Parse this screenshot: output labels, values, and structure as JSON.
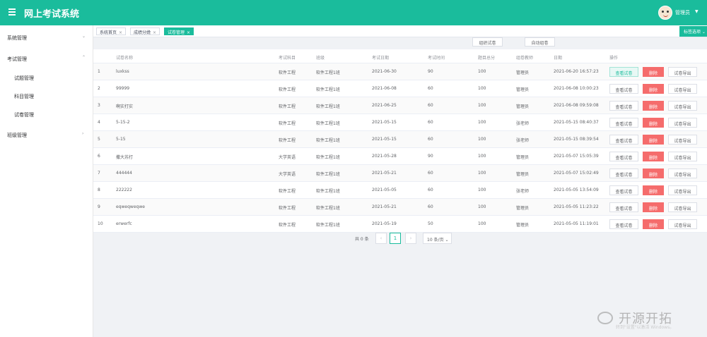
{
  "header": {
    "app_title": "网上考试系统",
    "username": "管理员",
    "colors": {
      "brand": "#1abc9c"
    }
  },
  "sidebar": {
    "items": [
      {
        "label": "系统管理",
        "chevron": "⌄"
      },
      {
        "label": "考试管理",
        "chevron": "⌃"
      },
      {
        "label": "试题管理"
      },
      {
        "label": "科目管理"
      },
      {
        "label": "试卷管理"
      },
      {
        "label": "班级管理",
        "chevron": "›"
      }
    ]
  },
  "tabs": [
    {
      "label": "系统首页"
    },
    {
      "label": "成绩分娩"
    },
    {
      "label": "试卷管理"
    }
  ],
  "tab_options": "标签选项 ⌄",
  "toolbar": {
    "manual_paper": "组织试卷",
    "auto_paper": "自动组卷"
  },
  "table": {
    "columns": [
      "试卷名称",
      "考试科目",
      "班级",
      "考试日期",
      "考试时间",
      "题目总分",
      "组卷教师",
      "日期",
      "操作"
    ],
    "rows": [
      {
        "no": "1",
        "name": "luxkss",
        "subject": "软件工程",
        "class": "软件工程1班",
        "exam_date": "2021-06-30",
        "duration": "90",
        "score": "100",
        "teacher": "管理员",
        "date": "2021-06-20 16:57:23"
      },
      {
        "no": "2",
        "name": "99999",
        "subject": "软件工程",
        "class": "软件工程1班",
        "exam_date": "2021-06-08",
        "duration": "60",
        "score": "100",
        "teacher": "管理员",
        "date": "2021-06-08 10:00:23"
      },
      {
        "no": "3",
        "name": "啊实打实",
        "subject": "软件工程",
        "class": "软件工程1班",
        "exam_date": "2021-06-25",
        "duration": "60",
        "score": "100",
        "teacher": "管理员",
        "date": "2021-06-08 09:59:08"
      },
      {
        "no": "4",
        "name": "5-15-2",
        "subject": "软件工程",
        "class": "软件工程1班",
        "exam_date": "2021-05-15",
        "duration": "60",
        "score": "100",
        "teacher": "张老师",
        "date": "2021-05-15 08:40:37"
      },
      {
        "no": "5",
        "name": "5-15",
        "subject": "软件工程",
        "class": "软件工程1班",
        "exam_date": "2021-05-15",
        "duration": "60",
        "score": "100",
        "teacher": "张老师",
        "date": "2021-05-15 08:39:54"
      },
      {
        "no": "6",
        "name": "撒大苏打",
        "subject": "大学英语",
        "class": "软件工程1班",
        "exam_date": "2021-05-28",
        "duration": "90",
        "score": "100",
        "teacher": "管理员",
        "date": "2021-05-07 15:05:39"
      },
      {
        "no": "7",
        "name": "444444",
        "subject": "大学英语",
        "class": "软件工程1班",
        "exam_date": "2021-05-21",
        "duration": "60",
        "score": "100",
        "teacher": "管理员",
        "date": "2021-05-07 15:02:49"
      },
      {
        "no": "8",
        "name": "222222",
        "subject": "软件工程",
        "class": "软件工程1班",
        "exam_date": "2021-05-05",
        "duration": "60",
        "score": "100",
        "teacher": "张老师",
        "date": "2021-05-05 13:54:09"
      },
      {
        "no": "9",
        "name": "eqweqweqwe",
        "subject": "软件工程",
        "class": "软件工程1班",
        "exam_date": "2021-05-21",
        "duration": "60",
        "score": "100",
        "teacher": "管理员",
        "date": "2021-05-05 11:23:22"
      },
      {
        "no": "10",
        "name": "erwerfc",
        "subject": "软件工程",
        "class": "软件工程1班",
        "exam_date": "2021-05-19",
        "duration": "50",
        "score": "100",
        "teacher": "管理员",
        "date": "2021-05-05 11:19:01"
      }
    ],
    "actions": {
      "view": "查看试卷",
      "delete": "删除",
      "export": "试卷导出"
    }
  },
  "pagination": {
    "total_text": "共 0 条",
    "prev": "‹",
    "current_page": "1",
    "next": "›",
    "page_size": "10 条/页 ⌄"
  },
  "watermark": {
    "big": "开源开拓",
    "small": "转到\"设置\"以激活 Windows。"
  }
}
